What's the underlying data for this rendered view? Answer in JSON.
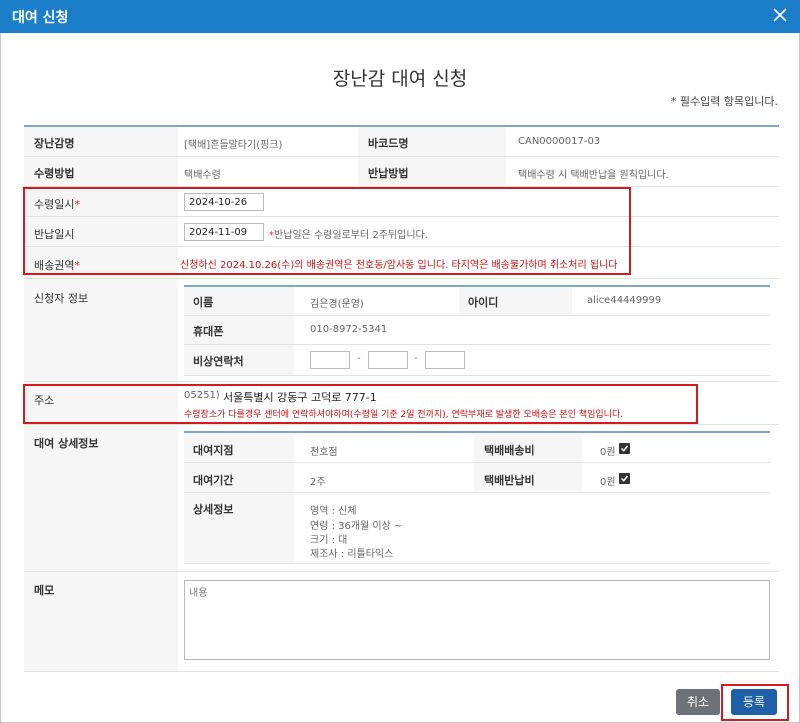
{
  "window": {
    "title": "대여 신청"
  },
  "form": {
    "heading": "장난감 대여 신청",
    "required_note": "* 필수입력 항목입니다.",
    "toy_name_label": "장난감명",
    "toy_name_value": "[택배]흔들말타기(핑크)",
    "barcode_label": "바코드명",
    "barcode_value": "CAN0000017-03",
    "receive_method_label": "수령방법",
    "receive_method_value": "택배수령",
    "return_method_label": "반납방법",
    "return_method_value": "택배수령 시 택배반납을 원칙입니다.",
    "receive_date_label": "수령일시",
    "receive_date_value": "2024-10-26",
    "return_date_label": "반납일시",
    "return_date_value": "2024-11-09",
    "return_date_note": "반납일은 수령일로부터 2주뒤입니다.",
    "delivery_area_label": "배송권역",
    "delivery_area_notice": "신청하신 2024.10.26(수)의 배송권역은 천호동/암사동 입니다. 타지역은 배송불가하며 취소처리 됩니다",
    "required_mark": "*"
  },
  "applicant": {
    "section_label": "신청자 정보",
    "name_label": "이름",
    "name_value": "김은경(운영)",
    "id_label": "아이디",
    "id_value": "alice44449999",
    "phone_label": "휴대폰",
    "phone_value": "010-8972-5341",
    "emergency_label": "비상연락처",
    "emergency_1": "",
    "emergency_2": "",
    "emergency_3": "",
    "dash": "-"
  },
  "address": {
    "label": "주소",
    "zip": "05251)",
    "value": "서울특별시 강동구 고덕로 777-1",
    "notice": "수령장소가 다를경우 센터에 연락하셔야하며(수령일 기준 2일 전까지), 연락부재로 발생한 오배송은 본인 책임입니다."
  },
  "rental_detail": {
    "section_label": "대여 상세정보",
    "branch_label": "대여지점",
    "branch_value": "천호점",
    "delivery_fee_label": "택배배송비",
    "delivery_fee_value": "0원",
    "period_label": "대여기간",
    "period_value": "2주",
    "return_fee_label": "택배반납비",
    "return_fee_value": "0원",
    "detail_label": "상세정보",
    "detail_lines": {
      "area": "영역 : 신체",
      "age": "연령 : 36개월 이상 ~",
      "size": "크기 : 대",
      "maker": "제조사 : 리틀타익스"
    }
  },
  "memo": {
    "label": "메모",
    "placeholder": "내용"
  },
  "buttons": {
    "cancel": "취소",
    "submit": "등록"
  },
  "colors": {
    "titlebar": "#1a7ec8",
    "highlight_box": "#d41a1a",
    "notice_red": "#cc1111",
    "submit_button": "#1e5fa8",
    "cancel_button": "#6c7278"
  }
}
